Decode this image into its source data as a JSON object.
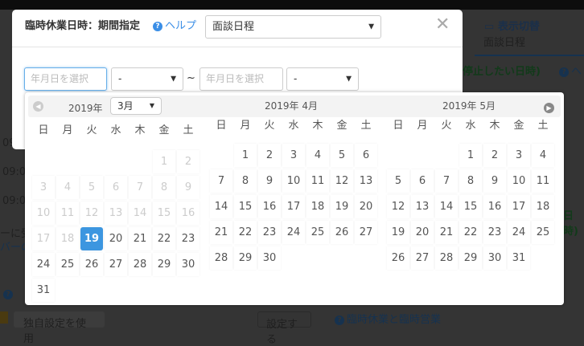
{
  "background": {
    "display_toggle_label": "表示切替",
    "display_value": "面談日程",
    "heading_fragment": "停止したい日時)",
    "help_fragment": "ヘ",
    "times": [
      "09:0",
      "09:0",
      "09:0",
      "09:0"
    ],
    "note_line1": "ーに受",
    "note_line2": "バーの",
    "right_fragment": "日時)",
    "custom_button": "独自設定を使用",
    "set_button": "設定する",
    "link_temp": "臨時休業と臨時営業"
  },
  "modal": {
    "title": "臨時休業日時：期間指定",
    "help_label": "ヘルプ",
    "type_select": "面談日程",
    "start_date_placeholder": "年月日を選択",
    "start_time": "-",
    "separator": "~",
    "end_date_placeholder": "年月日を選択",
    "end_time": "-"
  },
  "datepicker": {
    "year_label": "2019年",
    "month_select": "3月",
    "weekdays": [
      "日",
      "月",
      "火",
      "水",
      "木",
      "金",
      "土"
    ],
    "selected_date": "2019-03-19",
    "months": [
      {
        "title": "2019年 3月",
        "first_weekday": 5,
        "days": 31,
        "disabled_before": 19,
        "selected": 19
      },
      {
        "title": "2019年 4月",
        "first_weekday": 1,
        "days": 30,
        "disabled_before": 0,
        "selected": null
      },
      {
        "title": "2019年 5月",
        "first_weekday": 3,
        "days": 31,
        "disabled_before": 0,
        "selected": null
      }
    ]
  }
}
